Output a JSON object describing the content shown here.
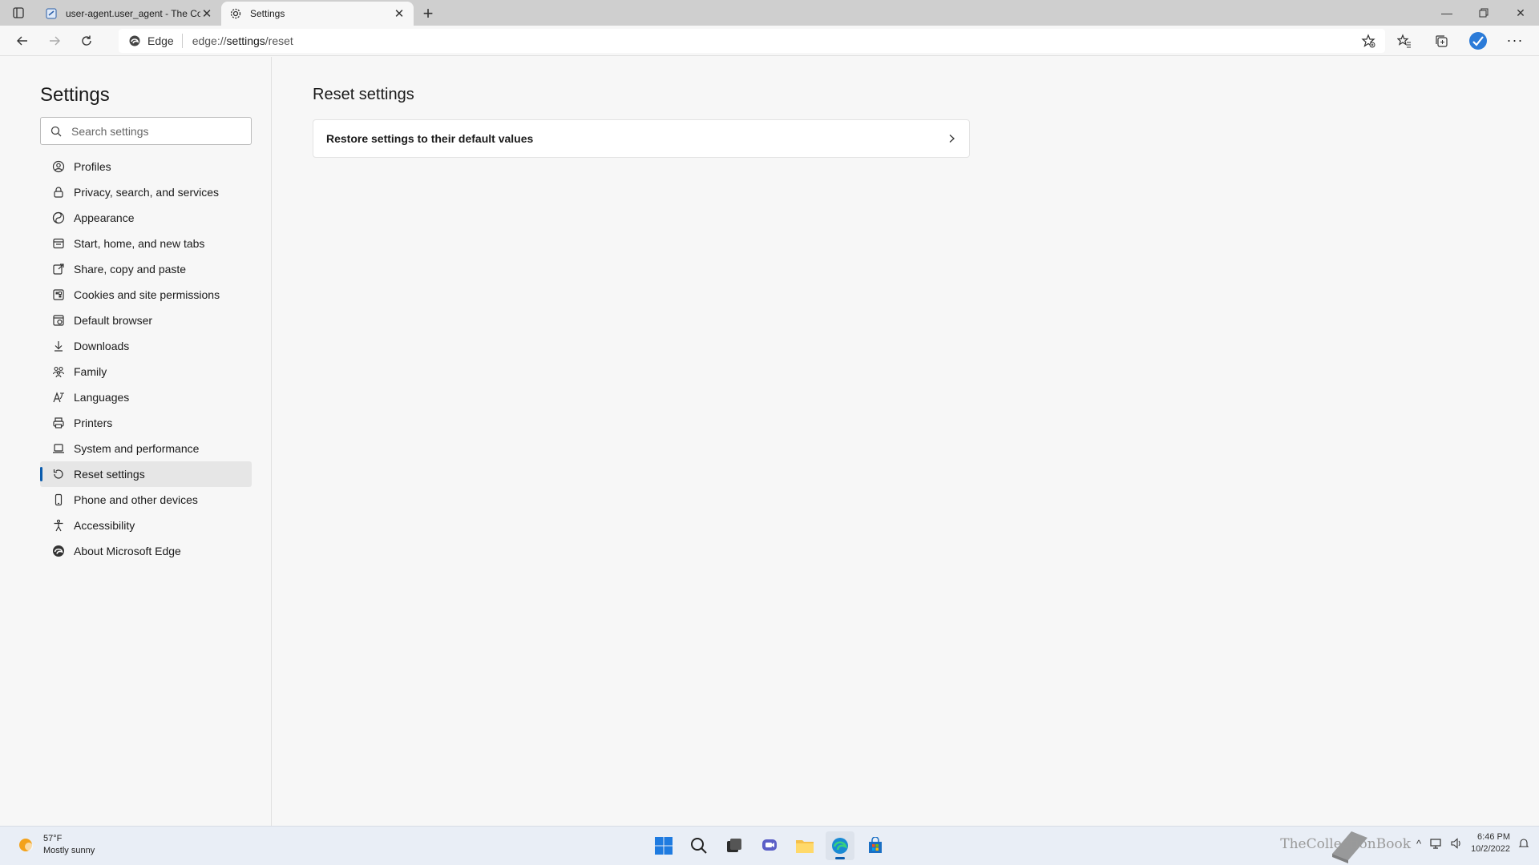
{
  "browser": {
    "tabs": [
      {
        "title": "user-agent.user_agent - The Coll",
        "active": false,
        "icon": "page-icon"
      },
      {
        "title": "Settings",
        "active": true,
        "icon": "gear-icon"
      }
    ],
    "address": {
      "site_label": "Edge",
      "url_prefix": "edge://",
      "url_path": "settings",
      "url_rest": "/reset"
    }
  },
  "sidebar": {
    "title": "Settings",
    "search_placeholder": "Search settings",
    "items": [
      {
        "label": "Profiles",
        "icon": "profile-icon"
      },
      {
        "label": "Privacy, search, and services",
        "icon": "lock-icon"
      },
      {
        "label": "Appearance",
        "icon": "appearance-icon"
      },
      {
        "label": "Start, home, and new tabs",
        "icon": "home-tabs-icon"
      },
      {
        "label": "Share, copy and paste",
        "icon": "share-icon"
      },
      {
        "label": "Cookies and site permissions",
        "icon": "cookies-icon"
      },
      {
        "label": "Default browser",
        "icon": "browser-icon"
      },
      {
        "label": "Downloads",
        "icon": "download-icon"
      },
      {
        "label": "Family",
        "icon": "family-icon"
      },
      {
        "label": "Languages",
        "icon": "language-icon"
      },
      {
        "label": "Printers",
        "icon": "printer-icon"
      },
      {
        "label": "System and performance",
        "icon": "laptop-icon"
      },
      {
        "label": "Reset settings",
        "icon": "reset-icon",
        "selected": true
      },
      {
        "label": "Phone and other devices",
        "icon": "phone-icon"
      },
      {
        "label": "Accessibility",
        "icon": "accessibility-icon"
      },
      {
        "label": "About Microsoft Edge",
        "icon": "edge-icon"
      }
    ]
  },
  "main": {
    "title": "Reset settings",
    "card_label": "Restore settings to their default values"
  },
  "taskbar": {
    "weather_temp": "57°F",
    "weather_desc": "Mostly sunny",
    "time": "6:46 PM",
    "date": "10/2/2022",
    "watermark": "TheCollectionBook"
  },
  "colors": {
    "accent": "#0b5cad",
    "tabstrip": "#cfcfcf",
    "background": "#f7f7f7"
  }
}
